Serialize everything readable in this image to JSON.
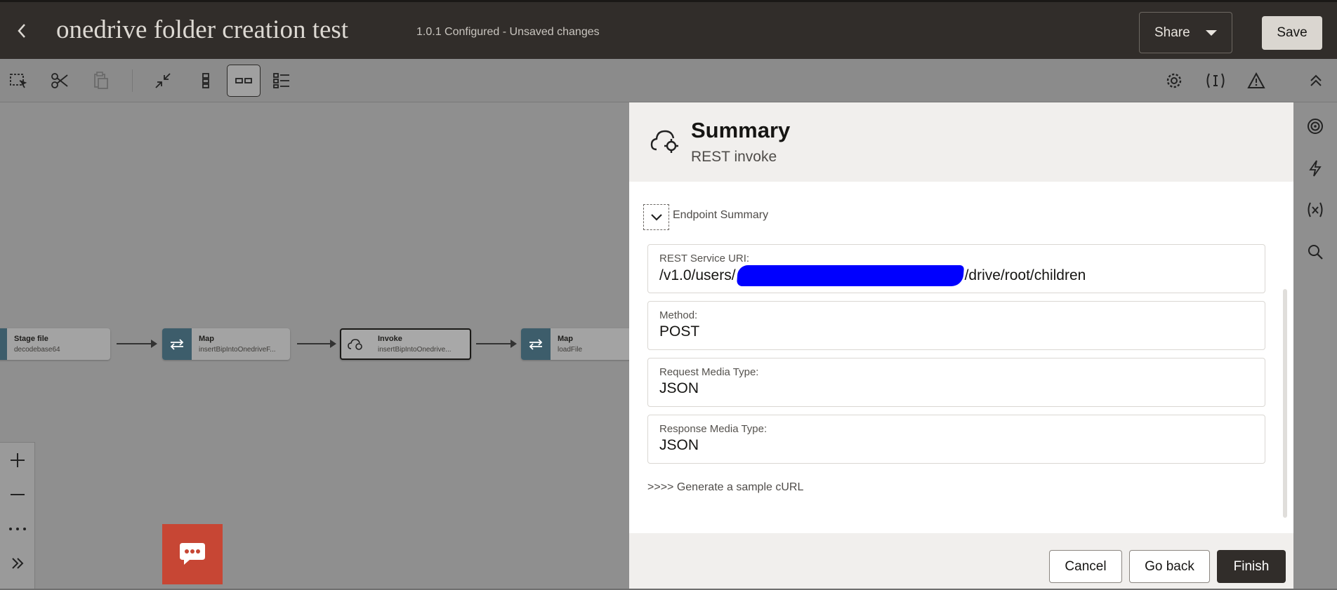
{
  "header": {
    "title": "onedrive folder creation test",
    "status": "1.0.1 Configured - Unsaved changes",
    "share_label": "Share",
    "save_label": "Save"
  },
  "toolbar": {
    "buttons": [
      "select-region",
      "cut",
      "paste",
      "collapse",
      "vertical-layout",
      "horizontal-layout",
      "details-layout"
    ],
    "right_buttons": [
      "settings",
      "tracking-variables",
      "warnings",
      "collapse-header"
    ]
  },
  "canvas": {
    "nodes": [
      {
        "title": "Stage file",
        "subtitle": "decodebase64",
        "icon": "stage-file-icon"
      },
      {
        "title": "Map",
        "subtitle": "insertBipIntoOnedriveF...",
        "icon": "map-arrows-icon"
      },
      {
        "title": "Invoke",
        "subtitle": "insertBipIntoOnedrive...",
        "icon": "cloud-invoke-icon"
      },
      {
        "title": "Map",
        "subtitle": "loadFile",
        "icon": "map-arrows-icon"
      }
    ]
  },
  "drawer": {
    "title": "Summary",
    "subtitle": "REST invoke",
    "section_label": "Endpoint Summary",
    "fields": {
      "uri": {
        "label": "REST Service URI:",
        "value_prefix": "/v1.0/users/",
        "value_suffix": "/drive/root/children"
      },
      "method": {
        "label": "Method:",
        "value": "POST"
      },
      "request_media": {
        "label": "Request Media Type:",
        "value": "JSON"
      },
      "response_media": {
        "label": "Response Media Type:",
        "value": "JSON"
      }
    },
    "curl_link": ">>>> Generate a sample cURL",
    "buttons": {
      "cancel": "Cancel",
      "go_back": "Go back",
      "finish": "Finish"
    }
  },
  "colors": {
    "header_bg": "#312d2a",
    "node_icon_bg": "#3d5d6b",
    "chat_bg": "#c74634",
    "redaction": "#0000ff",
    "primary_button": "#312d2a"
  }
}
